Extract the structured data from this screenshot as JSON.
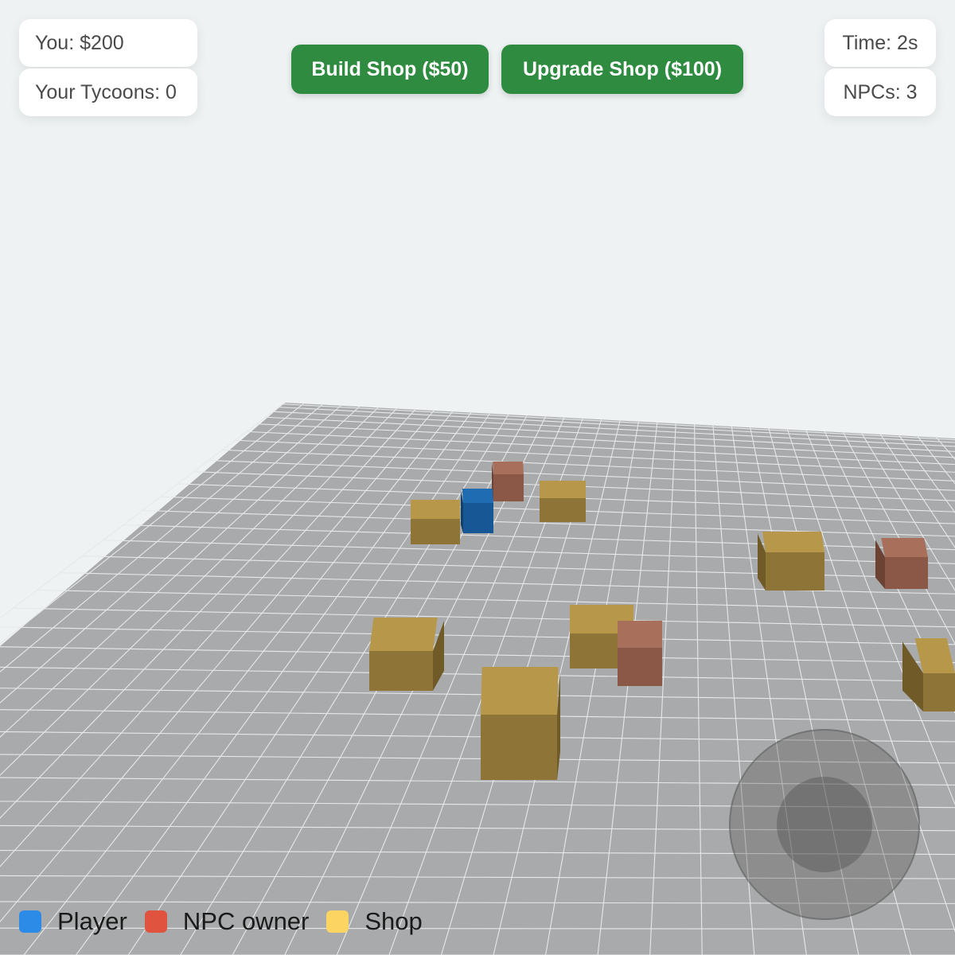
{
  "hud": {
    "money": "You: $200",
    "tycoons": "Your Tycoons: 0",
    "time": "Time: 2s",
    "npcs": "NPCs: 3"
  },
  "actions": {
    "build_label": "Build Shop ($50)",
    "upgrade_label": "Upgrade Shop ($100)"
  },
  "legend": [
    {
      "label": "Player",
      "color": "#2b8be6",
      "icon": "player-swatch"
    },
    {
      "label": "NPC owner",
      "color": "#e0533f",
      "icon": "npc-owner-swatch"
    },
    {
      "label": "Shop",
      "color": "#fcd462",
      "icon": "shop-swatch"
    }
  ],
  "colors": {
    "background": "#eef2f3",
    "ground": "#a9aaab",
    "grid_line": "#e6e8ea",
    "button": "#2e8b40",
    "shop_top": "#b7974a",
    "shop_front": "#8e7436",
    "shop_side": "#6f5a28",
    "npc_top": "#a8705a",
    "npc_front": "#8b5848",
    "npc_side": "#6b4234",
    "player_top": "#1f6cb3",
    "player_front": "#175796",
    "player_side": "#113f6e"
  },
  "scene": {
    "entities": [
      "player",
      "npc",
      "npc",
      "npc",
      "shop",
      "shop",
      "shop",
      "shop",
      "shop",
      "shop",
      "shop"
    ]
  }
}
